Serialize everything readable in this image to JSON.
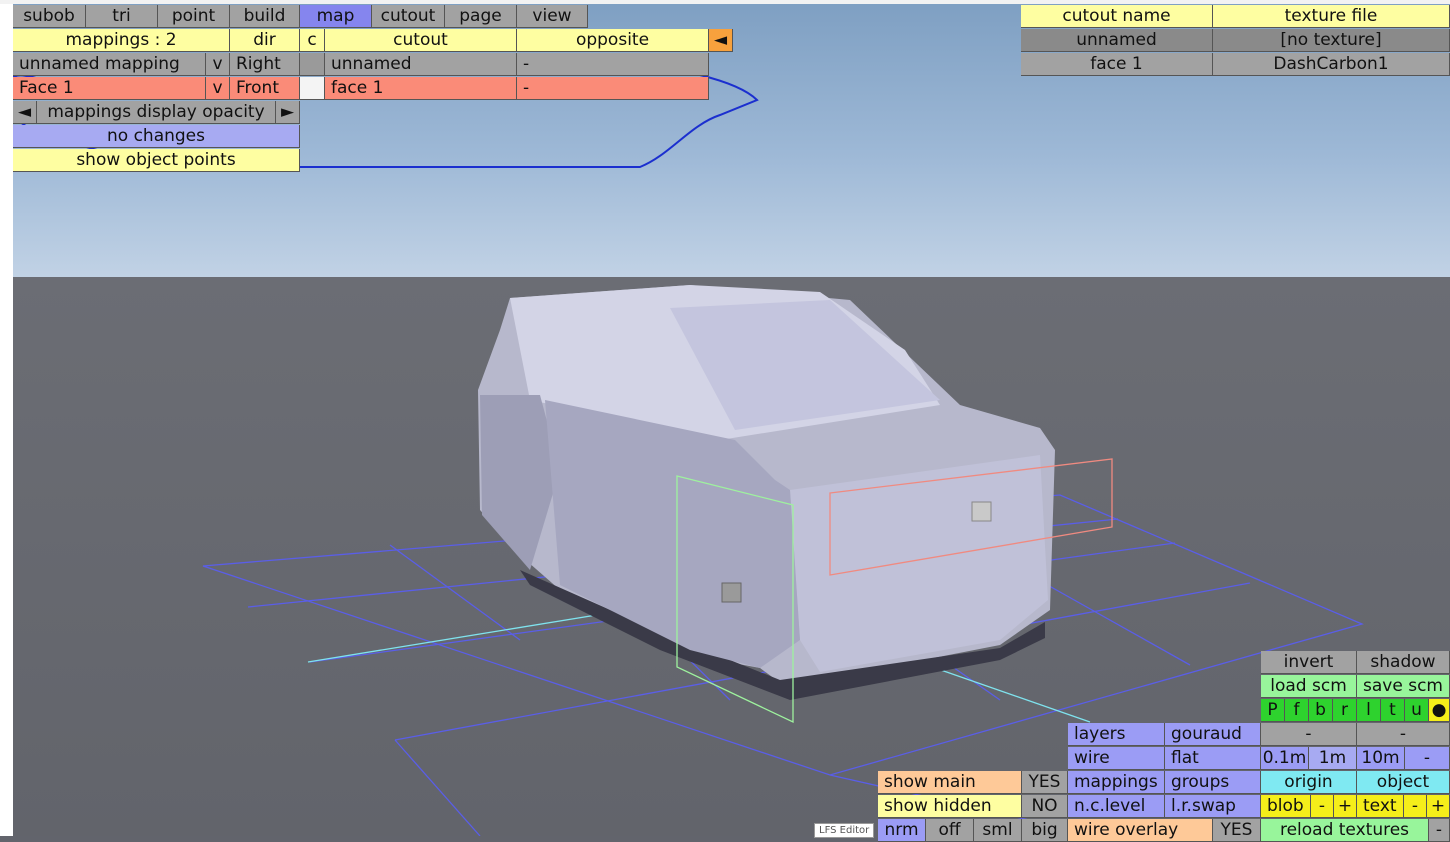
{
  "menu": [
    "subob",
    "tri",
    "point",
    "build",
    "map",
    "cutout",
    "page",
    "view"
  ],
  "mapping_panel": {
    "header": {
      "mappings": "mappings : 2",
      "dir": "dir",
      "c": "c",
      "cutout": "cutout",
      "opposite": "opposite",
      "arrow": "◄"
    },
    "rows": [
      {
        "name": "unnamed mapping",
        "v": "v",
        "dir": "Right",
        "cutout": "unnamed",
        "opposite": "-"
      },
      {
        "name": "Face 1",
        "v": "v",
        "dir": "Front",
        "cutout": "face 1",
        "opposite": "-"
      }
    ],
    "opacity": {
      "left": "◄",
      "label": "mappings display opacity",
      "right": "►"
    },
    "no_changes": "no changes",
    "show_object_points": "show object points"
  },
  "cutout_table": {
    "headers": [
      "cutout name",
      "texture file"
    ],
    "rows": [
      [
        "unnamed",
        "[no texture]"
      ],
      [
        "face 1",
        "DashCarbon1"
      ]
    ]
  },
  "bottom_right": {
    "invert": "invert",
    "shadow": "shadow",
    "load_scm": "load scm",
    "save_scm": "save scm",
    "view_buttons": [
      "P",
      "f",
      "b",
      "r",
      "l",
      "t",
      "u",
      "●"
    ],
    "dash1": "-",
    "dash2": "-",
    "layers": "layers",
    "gouraud": "gouraud",
    "wire": "wire",
    "flat": "flat",
    "grid": [
      "0.1m",
      "1m",
      "10m",
      "-"
    ],
    "show_main": "show main",
    "show_main_val": "YES",
    "mappings": "mappings",
    "groups": "groups",
    "origin": "origin",
    "object": "object",
    "show_hidden": "show hidden",
    "show_hidden_val": "NO",
    "nc_level": "n.c.level",
    "lr_swap": "l.r.swap",
    "blob": "blob",
    "blob_minus": "-",
    "blob_plus": "+",
    "text": "text",
    "text_minus": "-",
    "text_plus": "+",
    "size_buttons": [
      "nrm",
      "off",
      "sml",
      "big"
    ],
    "wire_overlay": "wire overlay",
    "wire_overlay_val": "YES",
    "reload_textures": "reload textures",
    "reload_dash": "-"
  },
  "editor_tag": "LFS Editor",
  "colors": {
    "selected_tab": "#8585ee",
    "highlight_row": "#fa8b78",
    "annotation": "#1b2fcf"
  }
}
